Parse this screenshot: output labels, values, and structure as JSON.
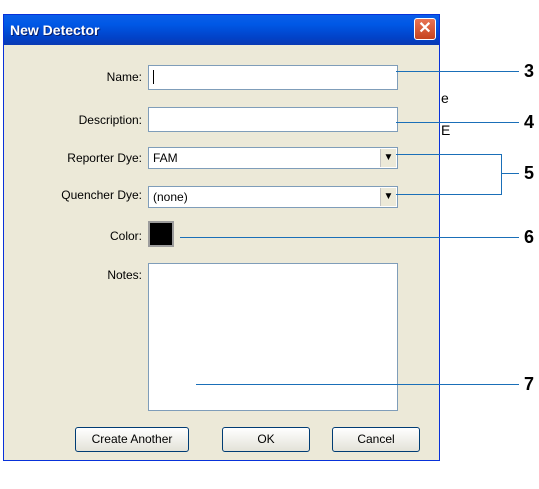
{
  "dialog": {
    "title": "New Detector",
    "close_glyph": "✕"
  },
  "form": {
    "name_label": "Name:",
    "name_value": "",
    "description_label": "Description:",
    "description_value": "",
    "reporter_label": "Reporter Dye:",
    "reporter_value": "FAM",
    "quencher_label": "Quencher Dye:",
    "quencher_value": "(none)",
    "color_label": "Color:",
    "color_value": "#000000",
    "notes_label": "Notes:",
    "notes_value": ""
  },
  "buttons": {
    "create_another": "Create Another",
    "ok": "OK",
    "cancel": "Cancel"
  },
  "callouts": [
    "3",
    "4",
    "5",
    "6",
    "7"
  ],
  "background_fragments": [
    "e",
    "E"
  ],
  "icons": {
    "dropdown": "▼"
  }
}
